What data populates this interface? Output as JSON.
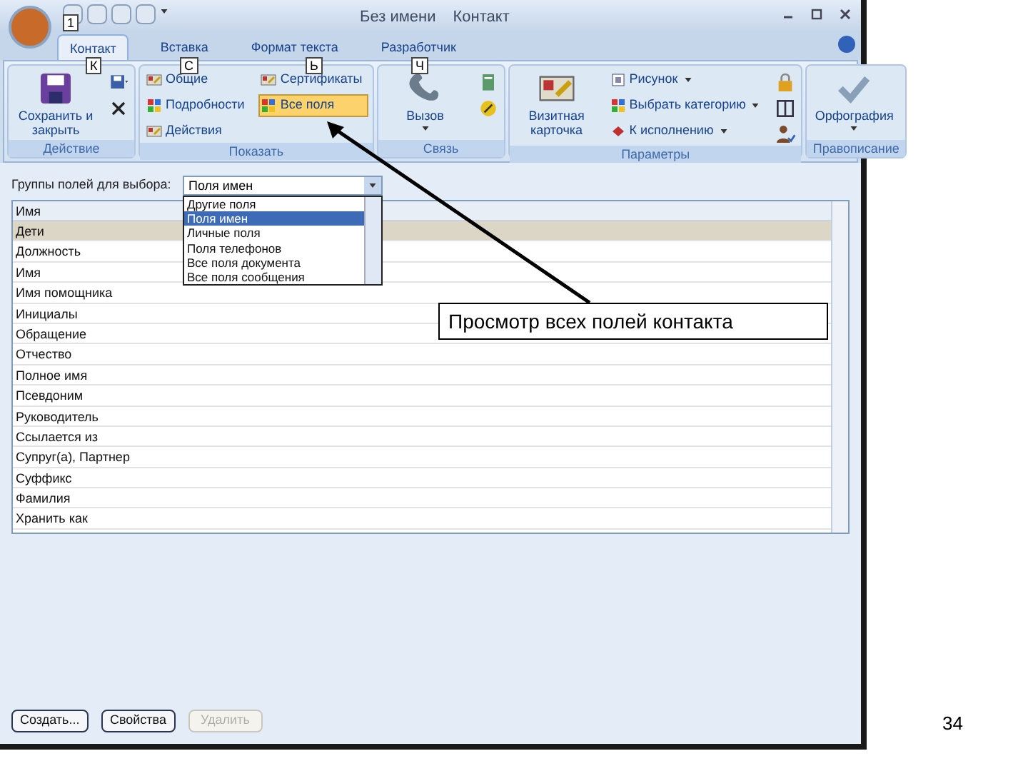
{
  "window": {
    "title": "Без имени",
    "subtitle": "Контакт",
    "quick_keytip": "1"
  },
  "tabs": [
    {
      "label": "Контакт",
      "selected": true,
      "keytip": "К"
    },
    {
      "label": "Вставка",
      "selected": false,
      "keytip": "С"
    },
    {
      "label": "Формат текста",
      "selected": false,
      "keytip": "Ь"
    },
    {
      "label": "Разработчик",
      "selected": false,
      "keytip": "Ч"
    }
  ],
  "ribbon": {
    "groups": [
      {
        "label": "Действие",
        "items": [
          {
            "kind": "large",
            "label": "Сохранить и закрыть",
            "caret": false
          },
          {
            "kind": "icons"
          }
        ]
      },
      {
        "label": "Показать",
        "items": [
          {
            "kind": "list",
            "entries": [
              {
                "label": "Общие",
                "selected": false
              },
              {
                "label": "Подробности",
                "selected": false
              },
              {
                "label": "Действия",
                "selected": false
              }
            ]
          },
          {
            "kind": "list",
            "entries": [
              {
                "label": "Сертификаты",
                "selected": false
              },
              {
                "label": "Все поля",
                "selected": true
              }
            ]
          }
        ]
      },
      {
        "label": "Связь",
        "items": [
          {
            "kind": "large",
            "label": "Вызов",
            "caret": true
          },
          {
            "kind": "icons"
          }
        ]
      },
      {
        "label": "Параметры",
        "items": [
          {
            "kind": "large",
            "label": "Визитная карточка",
            "caret": false
          },
          {
            "kind": "list",
            "entries": [
              {
                "label": "Рисунок",
                "selected": false,
                "caret": true
              },
              {
                "label": "Выбрать категорию",
                "selected": false,
                "caret": true
              },
              {
                "label": "К исполнению",
                "selected": false,
                "caret": true
              }
            ]
          },
          {
            "kind": "icons"
          }
        ]
      },
      {
        "label": "Правописание",
        "items": [
          {
            "kind": "large",
            "label": "Орфография",
            "caret": true
          }
        ]
      }
    ]
  },
  "field_group": {
    "label": "Группы полей для выбора:",
    "value": "Поля имен",
    "options": [
      {
        "label": "Другие поля",
        "selected": false
      },
      {
        "label": "Поля имен",
        "selected": true
      },
      {
        "label": "Личные поля",
        "selected": false
      },
      {
        "label": "Поля телефонов",
        "selected": false
      },
      {
        "label": "Все поля документа",
        "selected": false
      },
      {
        "label": "Все поля сообщения",
        "selected": false
      }
    ]
  },
  "fields_table": {
    "column": "Имя",
    "rows": [
      {
        "label": "Дети",
        "selected": true
      },
      {
        "label": "Должность",
        "selected": false
      },
      {
        "label": "Имя",
        "selected": false
      },
      {
        "label": "Имя помощника",
        "selected": false
      },
      {
        "label": "Инициалы",
        "selected": false
      },
      {
        "label": "Обращение",
        "selected": false
      },
      {
        "label": "Отчество",
        "selected": false
      },
      {
        "label": "Полное имя",
        "selected": false
      },
      {
        "label": "Псевдоним",
        "selected": false
      },
      {
        "label": "Руководитель",
        "selected": false
      },
      {
        "label": "Ссылается из",
        "selected": false
      },
      {
        "label": "Супруг(а), Партнер",
        "selected": false
      },
      {
        "label": "Суффикс",
        "selected": false
      },
      {
        "label": "Фамилия",
        "selected": false
      },
      {
        "label": "Хранить как",
        "selected": false
      }
    ]
  },
  "buttons": [
    {
      "label": "Создать...",
      "disabled": false
    },
    {
      "label": "Свойства",
      "disabled": false
    },
    {
      "label": "Удалить",
      "disabled": true
    }
  ],
  "callout": "Просмотр всех полей контакта",
  "slide_number": "34"
}
